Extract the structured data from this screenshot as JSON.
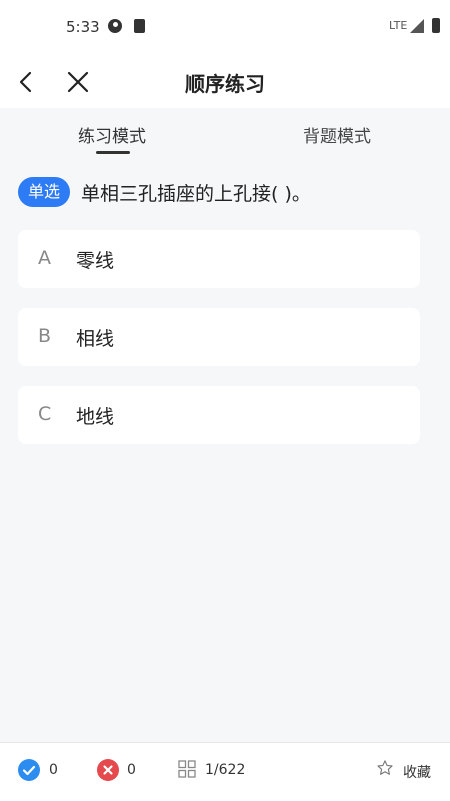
{
  "status_bar": {
    "time": "5:33",
    "network": "LTE"
  },
  "header": {
    "title": "顺序练习"
  },
  "tabs": [
    {
      "label": "练习模式",
      "active": true
    },
    {
      "label": "背题模式",
      "active": false
    }
  ],
  "question": {
    "type_badge": "单选",
    "text": "单相三孔插座的上孔接( )。"
  },
  "options": [
    {
      "letter": "A",
      "text": "零线"
    },
    {
      "letter": "B",
      "text": "相线"
    },
    {
      "letter": "C",
      "text": "地线"
    }
  ],
  "bottom_bar": {
    "correct_count": "0",
    "wrong_count": "0",
    "progress": "1/622",
    "favorite_label": "收藏"
  },
  "colors": {
    "accent": "#2e7bf6",
    "correct": "#2d8cf0",
    "wrong": "#e5484d",
    "background": "#f6f7f9"
  }
}
